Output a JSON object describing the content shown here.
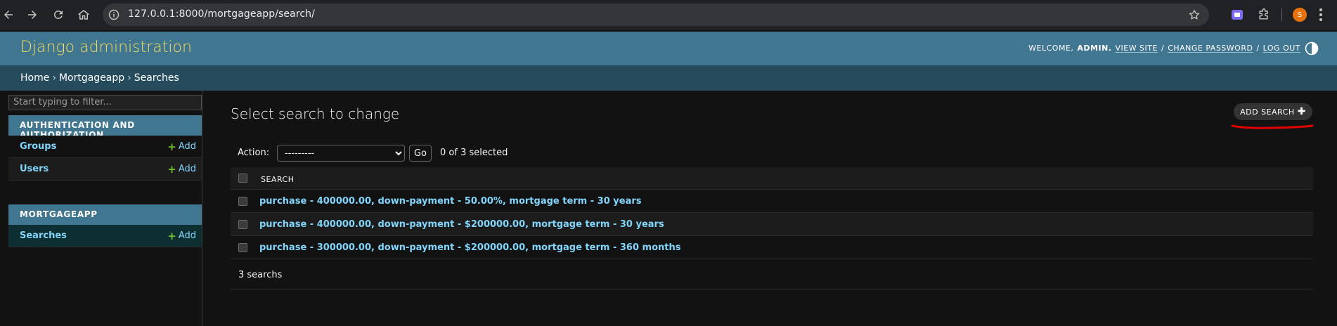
{
  "browser": {
    "url": "127.0.0.1:8000/mortgageapp/search/",
    "profile_initial": "S",
    "icons": [
      "back-arrow-icon",
      "forward-arrow-icon",
      "reload-icon",
      "home-icon",
      "site-info-icon",
      "bookmark-star-icon",
      "extension-icon",
      "puzzle-icon",
      "kebab-menu-icon"
    ]
  },
  "header": {
    "branding": "Django administration",
    "welcome": "WELCOME,",
    "user": "ADMIN.",
    "view_site": "VIEW SITE",
    "change_password": "CHANGE PASSWORD",
    "log_out": "LOG OUT",
    "slash": "/"
  },
  "breadcrumbs": {
    "home": "Home",
    "app": "Mortgageapp",
    "current": "Searches",
    "separator": "›"
  },
  "sidebar": {
    "filter_placeholder": "Start typing to filter...",
    "modules": [
      {
        "caption": "AUTHENTICATION AND AUTHORIZATION",
        "items": [
          {
            "label": "Groups",
            "add": "Add"
          },
          {
            "label": "Users",
            "add": "Add"
          }
        ]
      },
      {
        "caption": "MORTGAGEAPP",
        "items": [
          {
            "label": "Searches",
            "add": "Add"
          }
        ]
      }
    ]
  },
  "content": {
    "title": "Select search to change",
    "add_button": "ADD SEARCH",
    "action_label": "Action:",
    "action_select": "---------",
    "go_button": "Go",
    "selection_counter": "0 of 3 selected",
    "column_header": "SEARCH",
    "rows": [
      "purchase - 400000.00, down-payment - 50.00%, mortgage term - 30 years",
      "purchase - 400000.00, down-payment - $200000.00, mortgage term - 30 years",
      "purchase - 300000.00, down-payment - $200000.00, mortgage term - 360 months"
    ],
    "paginator": "3 searchs"
  },
  "colors": {
    "header_bg": "#417690",
    "branding": "#f5dd5d",
    "breadcrumbs_bg": "#264b5d",
    "link": "#81d4fa",
    "add_plus": "#70bf2b",
    "annotation": "#e00000"
  }
}
